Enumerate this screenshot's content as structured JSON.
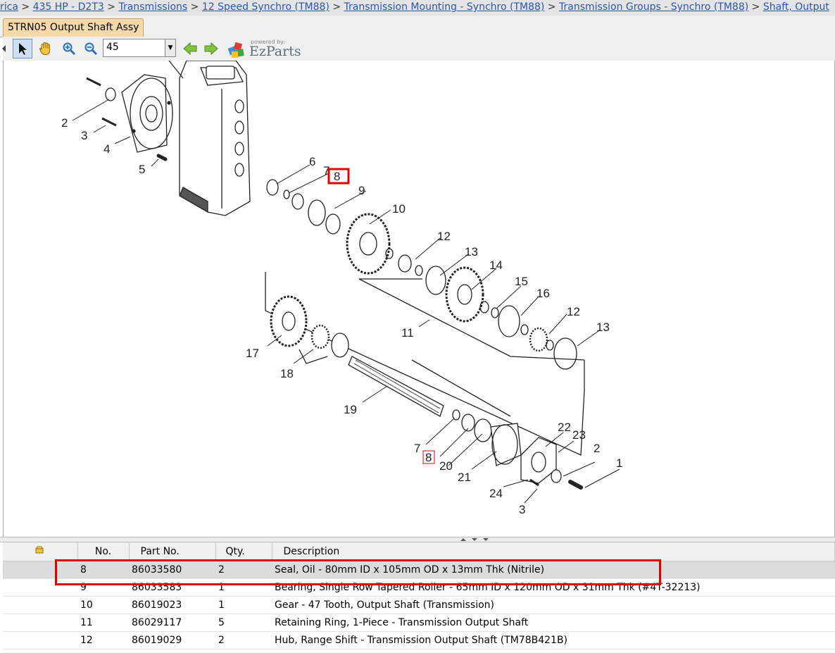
{
  "breadcrumb": [
    {
      "label": "rica"
    },
    {
      "label": "435 HP - D2T3"
    },
    {
      "label": "Transmissions"
    },
    {
      "label": "12 Speed Synchro (TM88)"
    },
    {
      "label": "Transmission Mounting - Synchro (TM88)"
    },
    {
      "label": "Transmission Groups - Synchro (TM88)"
    },
    {
      "label": "Shaft, Output"
    }
  ],
  "breadcrumb_separator": ">",
  "tab": {
    "label": "5TRN05 Output Shaft Assy"
  },
  "toolbar": {
    "zoom_value": "45",
    "logo_powered": "powered by:",
    "logo_name": "EzParts",
    "icons": [
      "select-arrow-icon",
      "pan-hand-icon",
      "zoom-in-icon",
      "zoom-out-icon",
      "back-arrow-icon",
      "forward-arrow-icon",
      "ezparts-logo-icon"
    ]
  },
  "diagram": {
    "callouts": [
      "1",
      "2",
      "2",
      "3",
      "3",
      "4",
      "5",
      "6",
      "7",
      "7",
      "8",
      "8",
      "9",
      "10",
      "11",
      "12",
      "12",
      "13",
      "13",
      "14",
      "15",
      "16",
      "17",
      "18",
      "19",
      "20",
      "21",
      "22",
      "23",
      "24"
    ],
    "highlighted_callout": "8",
    "accent_color": "#e00000"
  },
  "table": {
    "columns": [
      "No.",
      "Part No.",
      "Qty.",
      "Description"
    ],
    "rows": [
      {
        "no": "8",
        "part": "86033580",
        "qty": "2",
        "desc": "Seal, Oil - 80mm ID x 105mm OD x 13mm Thk (Nitrile)"
      },
      {
        "no": "9",
        "part": "86033583",
        "qty": "1",
        "desc": "Bearing, Single Row Tapered Roller - 65mm ID x 120mm OD x 31mm Thk (#4T-32213)"
      },
      {
        "no": "10",
        "part": "86019023",
        "qty": "1",
        "desc": "Gear - 47 Tooth, Output Shaft (Transmission)"
      },
      {
        "no": "11",
        "part": "86029117",
        "qty": "5",
        "desc": "Retaining Ring, 1-Piece - Transmission Output Shaft"
      },
      {
        "no": "12",
        "part": "86019029",
        "qty": "2",
        "desc": "Hub, Range Shift - Transmission Output Shaft (TM78B421B)"
      }
    ]
  }
}
